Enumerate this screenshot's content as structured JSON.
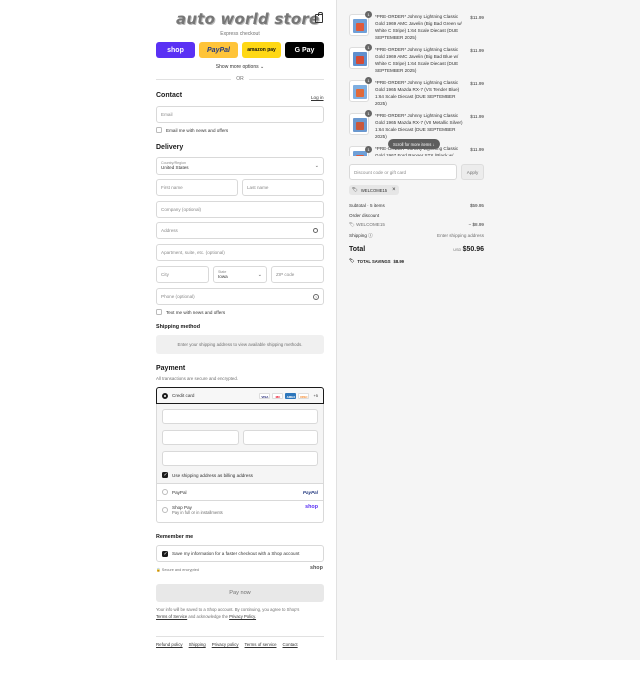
{
  "brand": {
    "logo_text": "auto world store"
  },
  "express": {
    "label": "Express checkout",
    "buttons": [
      {
        "label": "shop",
        "bg": "#5a31f4",
        "fg": "#ffffff"
      },
      {
        "label": "PayPal",
        "bg": "#ffc439",
        "fg": "#253b80"
      },
      {
        "label": "amazon pay",
        "bg": "#ffd814",
        "fg": "#111111"
      },
      {
        "label": "G Pay",
        "bg": "#000000",
        "fg": "#ffffff"
      }
    ],
    "more_options": "Show more options ⌄",
    "or": "OR"
  },
  "contact": {
    "title": "Contact",
    "login": "Log in",
    "email_placeholder": "Email",
    "news_label": "Email me with news and offers"
  },
  "delivery": {
    "title": "Delivery",
    "country_label": "Country/Region",
    "country_value": "United States",
    "first_name": "First name",
    "last_name": "Last name",
    "company": "Company (optional)",
    "address": "Address",
    "apartment": "Apartment, suite, etc. (optional)",
    "city": "City",
    "state_label": "State",
    "state_value": "Iowa",
    "zip": "ZIP code",
    "phone": "Phone (optional)",
    "text_offers": "Text me with news and offers"
  },
  "shipping_method": {
    "title": "Shipping method",
    "message": "Enter your shipping address to view available shipping methods."
  },
  "payment": {
    "title": "Payment",
    "subtitle": "All transactions are secure and encrypted.",
    "credit_card": "Credit card",
    "card_logos": [
      "VISA",
      "MC",
      "AMEX",
      "DISC",
      "+5"
    ],
    "billing_same": "Use shipping address as billing address",
    "paypal": "PayPal",
    "paypal_logo": "PayPal",
    "shop_pay": "Shop Pay",
    "shop_pay_sub": "Pay in full or in installments",
    "shop_pay_logo": "shop"
  },
  "remember": {
    "title": "Remember me",
    "save_info": "Save my information for a faster checkout with a Shop account",
    "secure": "Secure and encrypted",
    "shop_logo": "shop"
  },
  "pay_now": "Pay now",
  "legal": {
    "line1": "Your info will be saved to a Shop account. By continuing, you agree to Shop's",
    "tos": "Terms of Service",
    "and_ack": "and acknowledge the",
    "privacy": "Privacy Policy."
  },
  "footer_links": [
    "Refund policy",
    "Shipping",
    "Privacy policy",
    "Terms of service",
    "Contact"
  ],
  "cart": {
    "items": [
      {
        "qty": "1",
        "title": "*PRE-ORDER* Johnny Lightning Classic Gold 1969 AMC Javelin (Big Bad Green w/ White C Stripe) 1:64 Scale Diecast (DUE SEPTEMBER 2025)",
        "price": "$11.99"
      },
      {
        "qty": "1",
        "title": "*PRE-ORDER* Johnny Lightning Classic Gold 1969 AMC Javelin (Big Bad Blue w/ White C Stripe) 1:64 Scale Diecast (DUE SEPTEMBER 2025)",
        "price": "$11.99"
      },
      {
        "qty": "1",
        "title": "*PRE-ORDER* Johnny Lightning Classic Gold 1965 Mazda RX-7 (VS Tender Blue) 1:64 Scale Diecast (DUE SEPTEMBER 2025)",
        "price": "$11.99"
      },
      {
        "qty": "1",
        "title": "*PRE-ORDER* Johnny Lightning Classic Gold 1965 Mazda RX-7 (VII Metallic Silver) 1:64 Scale Diecast (DUE SEPTEMBER 2025)",
        "price": "$11.99"
      },
      {
        "qty": "1",
        "title": "*PRE-ORDER* Johnny Lightning Classic Gold 1967 Ford Ranger STX (Black w/",
        "price": "$11.99"
      }
    ],
    "scroll_hint": "Scroll for more items ↓",
    "discount_placeholder": "Discount code or gift card",
    "apply": "Apply",
    "applied_code": "WELCOME15",
    "subtotal_label": "Subtotal · 5 items",
    "subtotal_value": "$59.95",
    "order_discount_label": "Order discount",
    "discount_code": "WELCOME15",
    "discount_value": "− $8.99",
    "shipping_label": "Shipping ⓘ",
    "shipping_value": "Enter shipping address",
    "total_label": "Total",
    "currency": "USD",
    "total_value": "$50.96",
    "savings_label": "TOTAL SAVINGS",
    "savings_value": "$8.99"
  }
}
